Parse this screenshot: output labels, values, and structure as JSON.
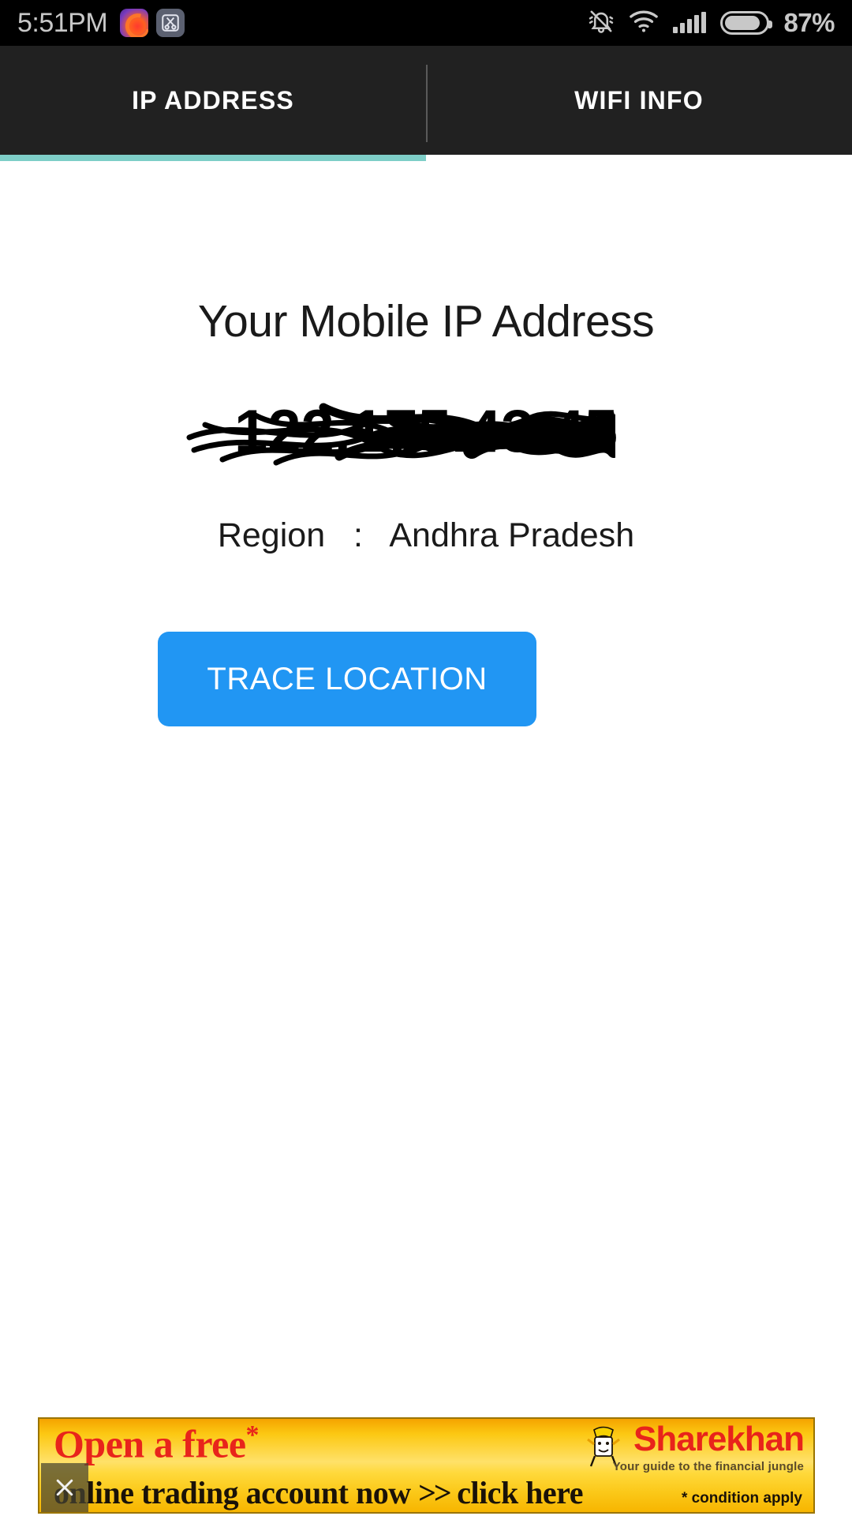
{
  "statusbar": {
    "time": "5:51PM",
    "battery_percent": "87%",
    "icons": [
      "firefox-app-icon",
      "screenshot-scissors-icon",
      "silent-bell-icon",
      "wifi-icon",
      "signal-bars-icon",
      "battery-icon"
    ]
  },
  "tabs": [
    {
      "label": "IP ADDRESS",
      "active": true
    },
    {
      "label": "WIFI INFO",
      "active": false
    }
  ],
  "main": {
    "headline": "Your Mobile IP Address",
    "ip_address": "122.175.43.45",
    "ip_redacted": true,
    "region_label": "Region",
    "region_separator": ":",
    "region_value": "Andhra Pradesh",
    "region_line": "Region   :   Andhra Pradesh",
    "trace_button_label": "TRACE LOCATION"
  },
  "ad": {
    "line1": "Open a free",
    "line1_star": "*",
    "line2": "online trading account now",
    "line2_arrows": ">>",
    "line2_cta": "click here",
    "brand_name": "Sharekhan",
    "brand_tagline": "Your guide to the financial jungle",
    "condition": "* condition apply",
    "close_label": "✕"
  },
  "colors": {
    "status_bar_bg": "#000000",
    "tab_bar_bg": "#212121",
    "tab_indicator": "#7ecec7",
    "accent_button": "#2196f3",
    "page_bg": "#ffffff",
    "ad_yellow": "#ffd93b",
    "ad_red": "#e8241b"
  }
}
